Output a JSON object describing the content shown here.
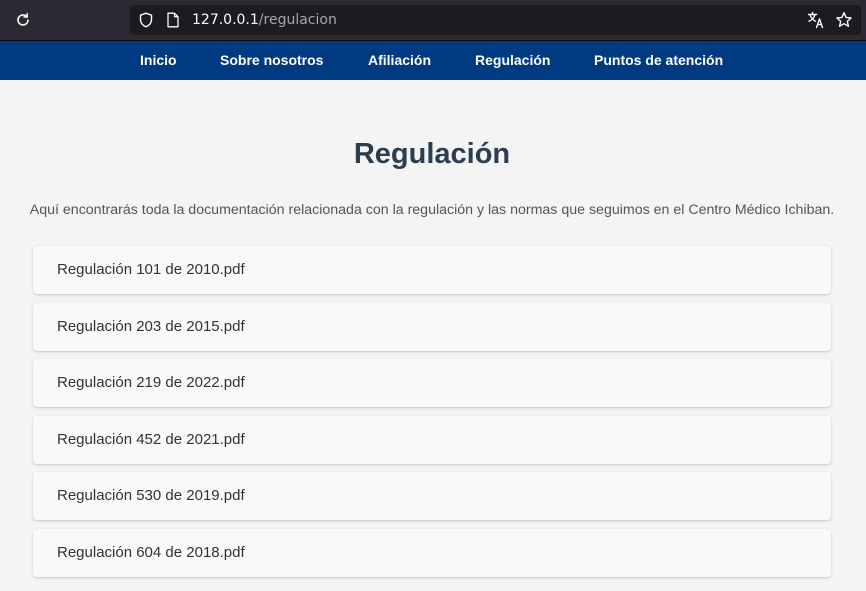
{
  "browser": {
    "url_host": "127.0.0.1",
    "url_path": "/regulacion",
    "icons": [
      "reload-icon",
      "shield-icon",
      "page-icon",
      "translate-icon",
      "star-icon"
    ]
  },
  "nav": {
    "items": [
      {
        "label": "Inicio"
      },
      {
        "label": "Sobre nosotros"
      },
      {
        "label": "Afiliación"
      },
      {
        "label": "Regulación"
      },
      {
        "label": "Puntos de atención"
      }
    ]
  },
  "main": {
    "title": "Regulación",
    "intro": "Aquí encontrarás toda la documentación relacionada con la regulación y las normas que seguimos en el Centro Médico Ichiban.",
    "documents": [
      {
        "label": "Regulación 101 de 2010.pdf"
      },
      {
        "label": "Regulación 203 de 2015.pdf"
      },
      {
        "label": "Regulación 219 de 2022.pdf"
      },
      {
        "label": "Regulación 452 de 2021.pdf"
      },
      {
        "label": "Regulación 530 de 2019.pdf"
      },
      {
        "label": "Regulación 604 de 2018.pdf"
      }
    ]
  },
  "colors": {
    "nav_background": "#003b82",
    "title": "#2c3e50",
    "page_background": "#f4f4f4"
  }
}
